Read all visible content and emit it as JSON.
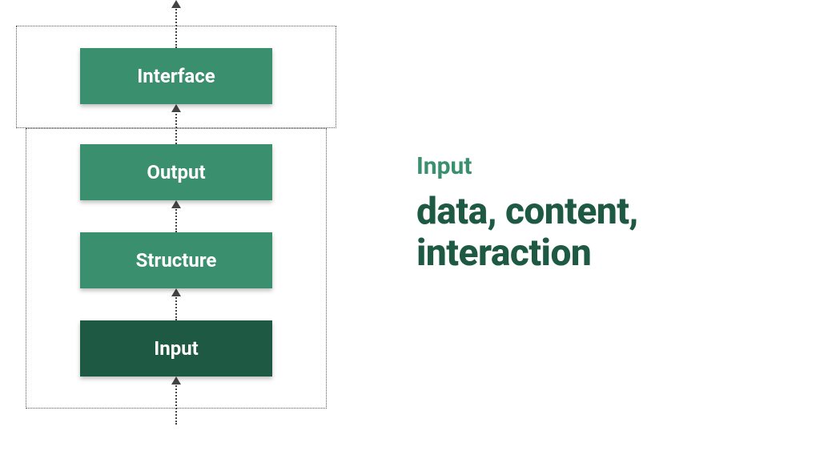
{
  "diagram": {
    "boxes": [
      {
        "id": "interface",
        "label": "Interface",
        "variant": "light"
      },
      {
        "id": "output",
        "label": "Output",
        "variant": "light"
      },
      {
        "id": "structure",
        "label": "Structure",
        "variant": "light"
      },
      {
        "id": "input",
        "label": "Input",
        "variant": "dark"
      }
    ],
    "flow": "input -> structure -> output -> interface -> (out)",
    "groups": [
      {
        "id": "top-group",
        "contains": [
          "interface"
        ]
      },
      {
        "id": "bottom-group",
        "contains": [
          "output",
          "structure",
          "input"
        ]
      }
    ]
  },
  "text": {
    "heading": "Input",
    "body": "data, content, interaction"
  },
  "colors": {
    "box_light": "#3a8f6e",
    "box_dark": "#1e5944",
    "heading": "#3a8f6e",
    "body": "#1e5944",
    "dotted_border": "#555555"
  }
}
